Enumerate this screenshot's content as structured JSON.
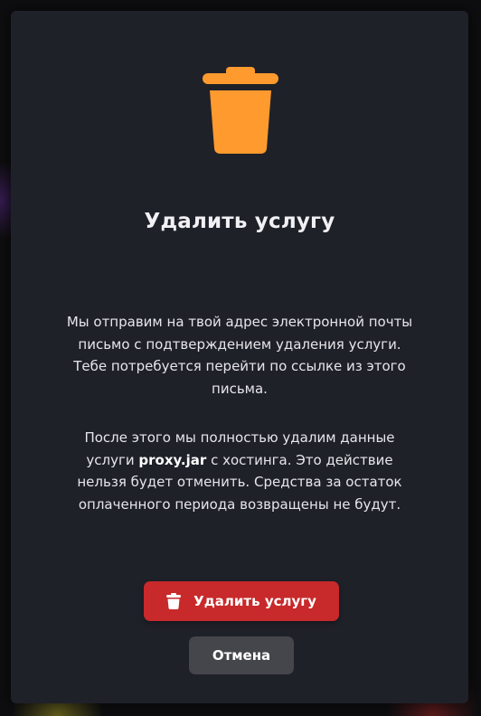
{
  "dialog": {
    "icon": "trash-icon",
    "accent_color": "#ff9a2e",
    "title": "Удалить услугу",
    "paragraph1": "Мы отправим на твой адрес электронной почты письмо с подтверждением удаления услуги. Тебе потребуется перейти по ссылке из этого письма.",
    "paragraph2_before": "После этого мы полностью удалим данные услуги ",
    "service_name": "proxy.jar",
    "paragraph2_after": " с хостинга. Это действие нельзя будет отменить. Средства за остаток оплаченного периода возвращены не будут.",
    "confirm_button": {
      "label": "Удалить услугу",
      "icon": "trash-icon",
      "color": "#c8292b"
    },
    "cancel_button": {
      "label": "Отмена",
      "color": "#45454c"
    }
  }
}
